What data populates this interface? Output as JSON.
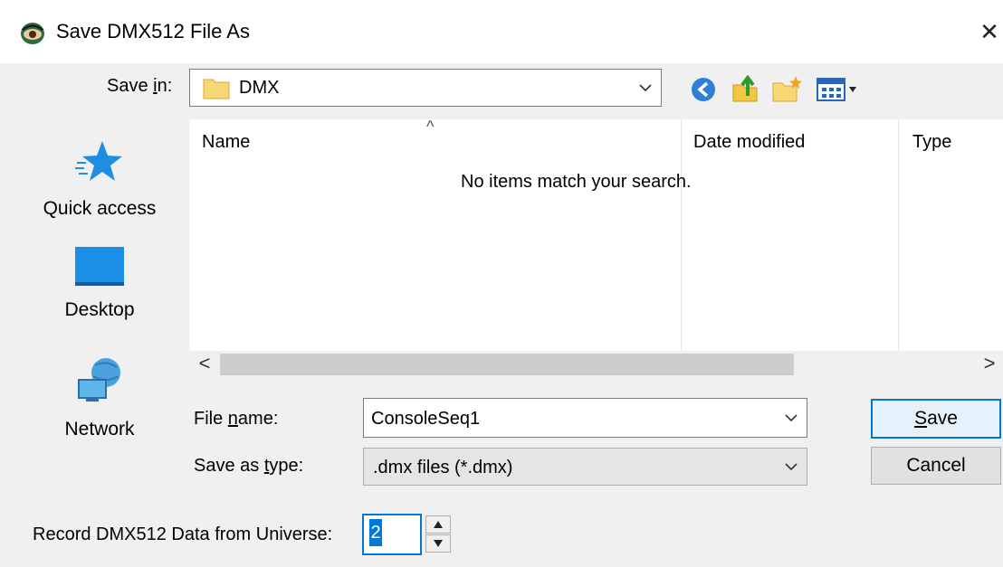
{
  "window": {
    "title": "Save DMX512 File As",
    "close_glyph": "✕"
  },
  "toolbar": {
    "save_in_label_pre": "Save ",
    "save_in_label_hot": "i",
    "save_in_label_post": "n:",
    "save_in_value": "DMX",
    "icons": [
      "back-icon",
      "up-folder-icon",
      "new-folder-icon",
      "view-menu-icon"
    ]
  },
  "places": [
    {
      "label": "Quick access",
      "icon": "star-icon"
    },
    {
      "label": "Desktop",
      "icon": "desktop-icon"
    },
    {
      "label": "Network",
      "icon": "network-icon"
    }
  ],
  "list": {
    "columns": [
      "Name",
      "Date modified",
      "Type"
    ],
    "sort_glyph": "^",
    "empty_message": "No items match your search."
  },
  "scroll": {
    "left": "<",
    "right": ">"
  },
  "file_name": {
    "label_pre": "File ",
    "label_hot": "n",
    "label_post": "ame:",
    "value": "ConsoleSeq1"
  },
  "save_type": {
    "label_pre": "Save as ",
    "label_hot": "t",
    "label_post": "ype:",
    "value": ".dmx files (*.dmx)"
  },
  "buttons": {
    "save_hot": "S",
    "save_rest": "ave",
    "cancel": "Cancel"
  },
  "universe": {
    "label": "Record DMX512 Data from Universe:",
    "value": "2"
  },
  "colors": {
    "accent": "#0078d7",
    "folder": "#f8d775",
    "window": "#f0f0f0"
  }
}
